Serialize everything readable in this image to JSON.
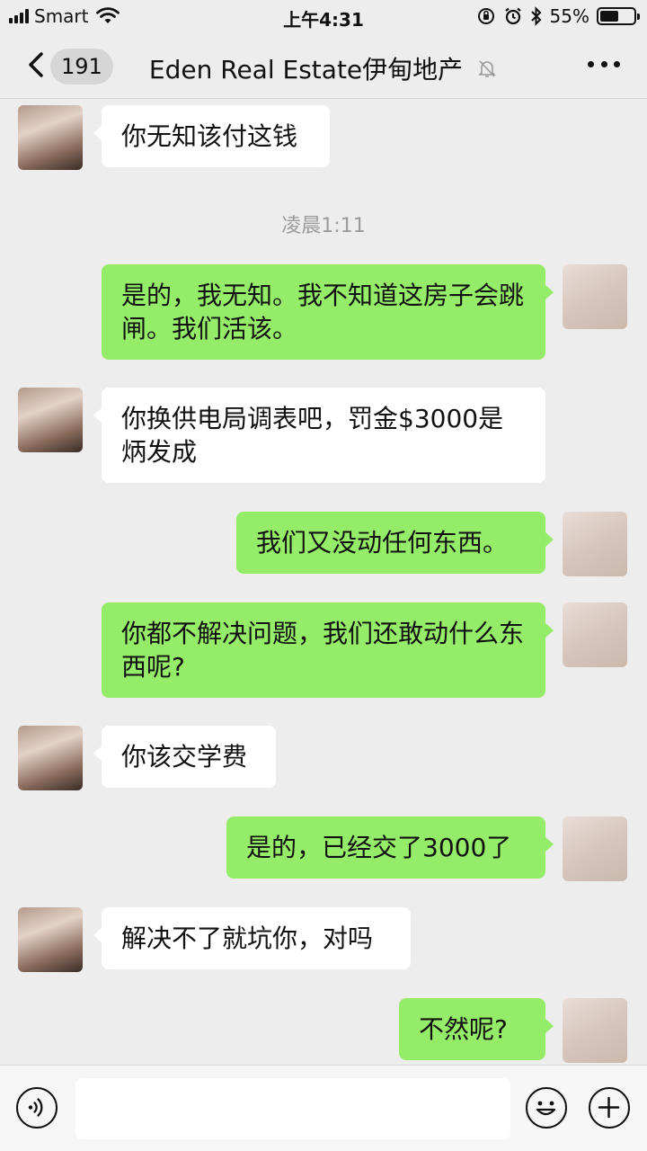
{
  "status_bar": {
    "carrier": "Smart",
    "time": "上午4:31",
    "battery": "55%",
    "battery_level": 0.55
  },
  "nav": {
    "back_count": "191",
    "title": "Eden Real Estate伊甸地产",
    "icons": [
      "chevron-left-icon",
      "mute-bell-icon",
      "more-icon"
    ]
  },
  "chat": {
    "timestamp": "凌晨1:11",
    "messages": [
      {
        "side": "in",
        "text": "你无知该付这钱"
      },
      {
        "side": "out",
        "text": "是的，我无知。我不知道这房子会跳闸。我们活该。"
      },
      {
        "side": "in",
        "text": "你换供电局调表吧，罚金$3000是炳发成"
      },
      {
        "side": "out",
        "text": "我们又没动任何东西。"
      },
      {
        "side": "out",
        "text": "你都不解决问题，我们还敢动什么东西呢?"
      },
      {
        "side": "in",
        "text": "你该交学费"
      },
      {
        "side": "out",
        "text": "是的，已经交了3000了"
      },
      {
        "side": "in",
        "text": "解决不了就坑你，对吗"
      },
      {
        "side": "out",
        "text": "不然呢?"
      }
    ]
  },
  "input_bar": {
    "placeholder": "",
    "icons": [
      "voice-icon",
      "emoji-icon",
      "plus-icon"
    ]
  }
}
